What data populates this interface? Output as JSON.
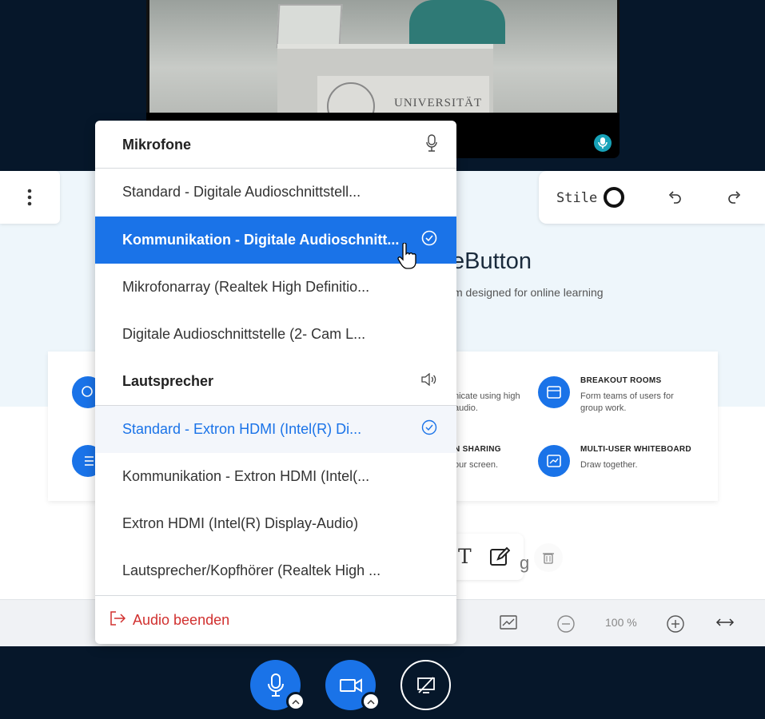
{
  "webcam": {
    "plaque_text": "UNIVERSITÄT"
  },
  "whiteboard": {
    "title": "eButton",
    "subtitle": "m designed for online learning",
    "features": [
      {
        "title": "",
        "desc": "nicate using high\naudio."
      },
      {
        "title": "BREAKOUT ROOMS",
        "desc": "Form teams of users for\ngroup work."
      },
      {
        "title": "N SHARING",
        "desc": "our screen."
      },
      {
        "title": "MULTI-USER WHITEBOARD",
        "desc": "Draw together."
      }
    ],
    "zoom": "100 %",
    "partial_text": "g"
  },
  "style_panel": {
    "label": "Stile"
  },
  "audio_menu": {
    "microphones_header": "Mikrofone",
    "microphones": [
      "Standard - Digitale Audioschnittstell...",
      "Kommunikation - Digitale Audioschnitt...",
      "Mikrofonarray (Realtek High Definitio...",
      "Digitale Audioschnittstelle (2- Cam L..."
    ],
    "speakers_header": "Lautsprecher",
    "speakers": [
      "Standard - Extron HDMI (Intel(R) Di...",
      "Kommunikation - Extron HDMI (Intel(...",
      "Extron HDMI (Intel(R) Display-Audio)",
      "Lautsprecher/Kopfhörer (Realtek High ..."
    ],
    "leave_audio": "Audio beenden"
  },
  "colors": {
    "accent": "#1a73e8",
    "navy": "#06172a",
    "danger": "#d1302f"
  }
}
